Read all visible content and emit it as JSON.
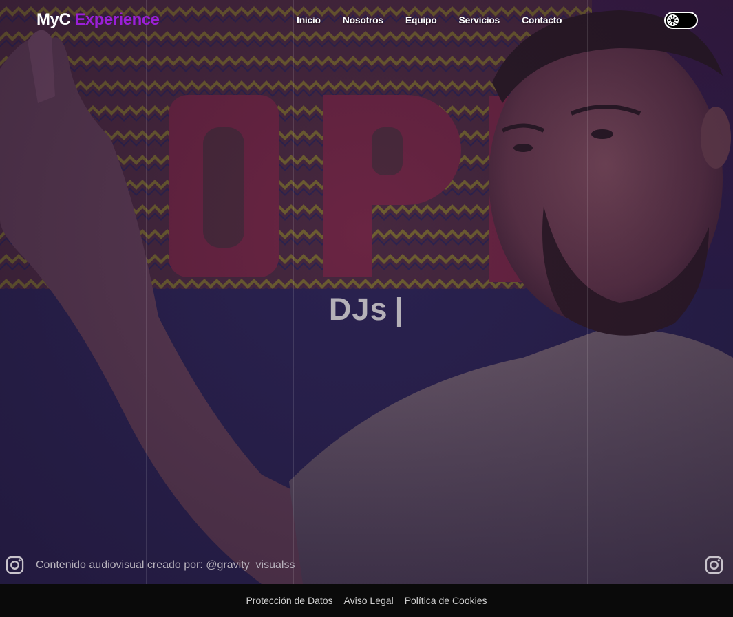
{
  "header": {
    "logo_part1": "MyC",
    "logo_part2": "Experience",
    "nav": [
      "Inicio",
      "Nosotros",
      "Equipo",
      "Servicios",
      "Contacto"
    ],
    "theme_toggle_icon": "sun-icon"
  },
  "hero": {
    "title": "DJs",
    "cursor": "|"
  },
  "credit": {
    "text": "Contenido audiovisual creado por: @gravity_visualss",
    "icon": "instagram-icon"
  },
  "footer": {
    "links": [
      "Protección de Datos",
      "Aviso Legal",
      "Política de Cookies"
    ]
  },
  "colors": {
    "accent": "#9b1fd6",
    "footer_bg": "#0a0a0a",
    "hero_text": "#b5b1b8"
  }
}
